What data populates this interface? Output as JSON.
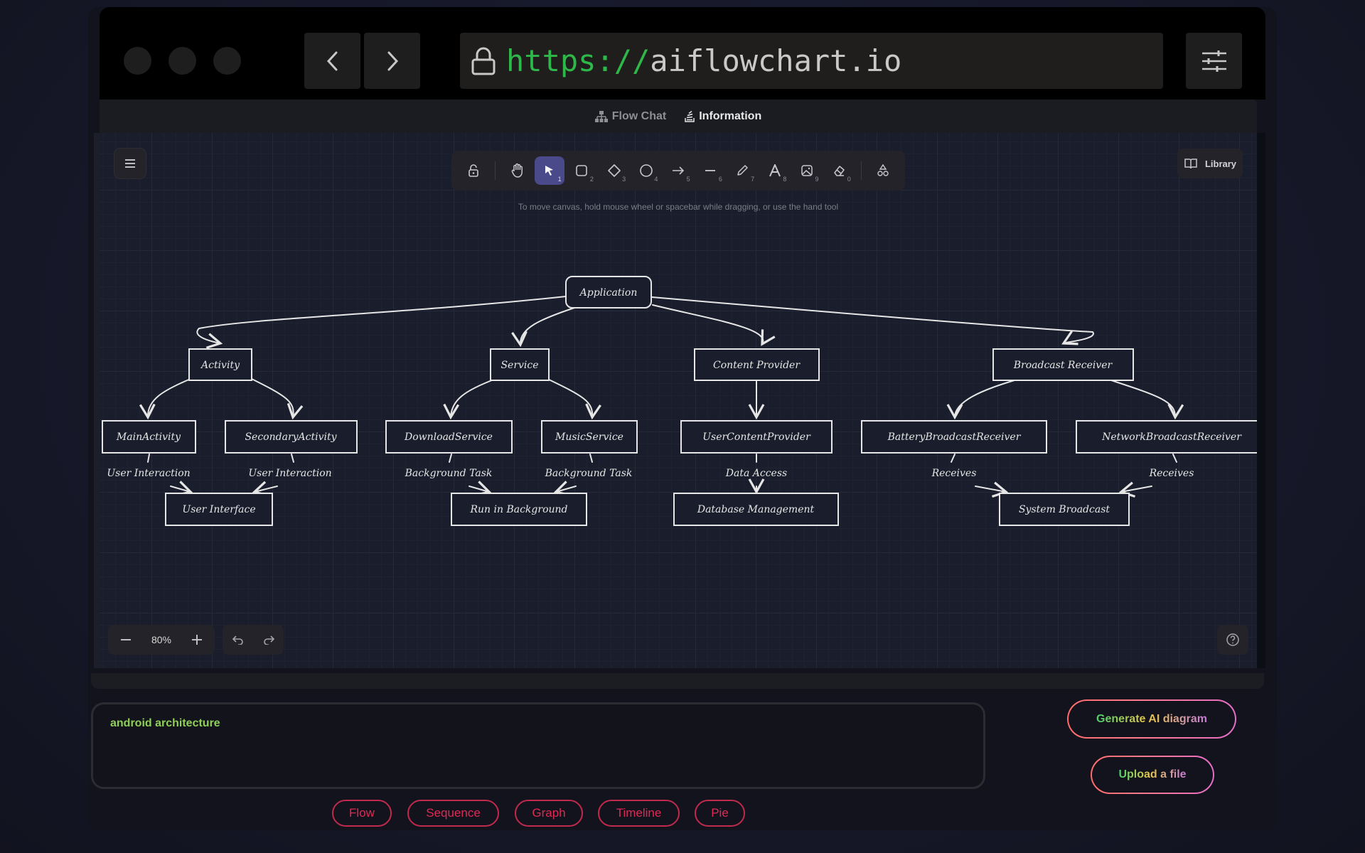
{
  "browser": {
    "url_protocol": "https://",
    "url_host": "aiflowchart.io",
    "back_icon": "chevron-left-icon",
    "forward_icon": "chevron-right-icon",
    "settings_icon": "sliders-icon",
    "lock_icon": "lock-icon"
  },
  "tabs": [
    {
      "label": "Flow Chat",
      "icon": "sitemap-icon",
      "active": false
    },
    {
      "label": "Information",
      "icon": "stack-icon",
      "active": true
    }
  ],
  "toolbar": {
    "tools": [
      {
        "name": "lock",
        "key": ""
      },
      {
        "name": "hand",
        "key": ""
      },
      {
        "name": "selection",
        "key": "1",
        "active": true
      },
      {
        "name": "rectangle",
        "key": "2"
      },
      {
        "name": "diamond",
        "key": "3"
      },
      {
        "name": "ellipse",
        "key": "4"
      },
      {
        "name": "arrow",
        "key": "5"
      },
      {
        "name": "line",
        "key": "6"
      },
      {
        "name": "draw",
        "key": "7"
      },
      {
        "name": "text",
        "key": "8"
      },
      {
        "name": "image",
        "key": "9"
      },
      {
        "name": "eraser",
        "key": "0"
      },
      {
        "name": "extra-shapes",
        "key": ""
      }
    ],
    "hint": "To move canvas, hold mouse wheel or spacebar while dragging, or use the hand tool"
  },
  "library_label": "Library",
  "zoom": {
    "value": "80%"
  },
  "diagram": {
    "nodes": {
      "application": "Application",
      "activity": "Activity",
      "service": "Service",
      "content_provider": "Content Provider",
      "broadcast_receiver": "Broadcast Receiver",
      "main_activity": "MainActivity",
      "secondary_activity": "SecondaryActivity",
      "download_service": "DownloadService",
      "music_service": "MusicService",
      "user_content_provider": "UserContentProvider",
      "battery_receiver": "BatteryBroadcastReceiver",
      "network_receiver": "NetworkBroadcastReceiver",
      "user_interface": "User Interface",
      "run_in_background": "Run in Background",
      "database_management": "Database Management",
      "system_broadcast": "System Broadcast"
    },
    "edge_labels": {
      "main_ui": "User Interaction",
      "secondary_ui": "User Interaction",
      "download_bg": "Background Task",
      "music_bg": "Background Task",
      "data_access": "Data Access",
      "battery_receives": "Receives",
      "network_receives": "Receives"
    }
  },
  "prompt": {
    "value": "android architecture"
  },
  "chips": [
    "Flow",
    "Sequence",
    "Graph",
    "Timeline",
    "Pie"
  ],
  "actions": {
    "generate_label": "Generate AI diagram",
    "upload_label": "Upload a file"
  },
  "colors": {
    "url_protocol": "#2fb84a",
    "chip_accent": "#e02a55",
    "prompt_text": "#8fcf57",
    "active_tool": "#4a4a8a"
  }
}
